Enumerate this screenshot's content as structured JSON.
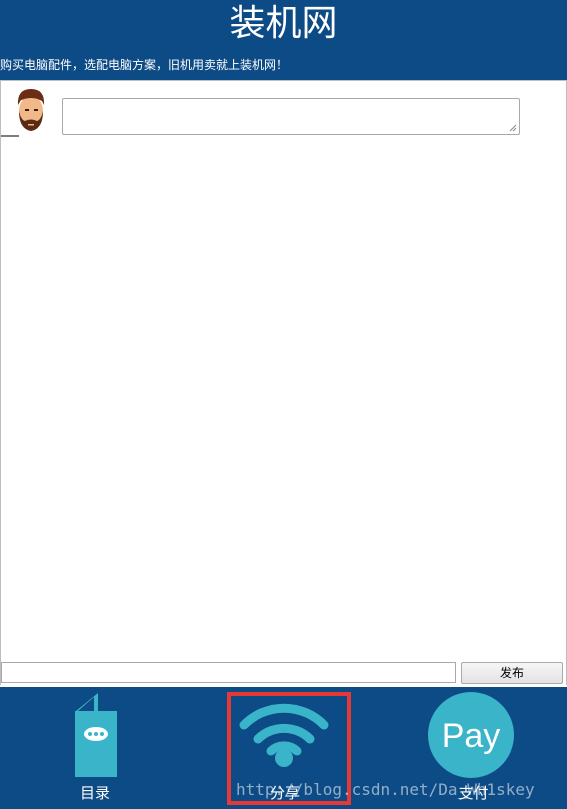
{
  "header": {
    "title": "装机网",
    "slogan": "购买电脑配件，选配电脑方案，旧机用卖就上装机网！"
  },
  "comment": {
    "value": "",
    "placeholder": ""
  },
  "post_bar": {
    "input_value": "",
    "button_label": "发布"
  },
  "nav": {
    "items": [
      {
        "label": "目录",
        "icon": "menu-booklet-icon"
      },
      {
        "label": "分享",
        "icon": "wifi-share-icon",
        "highlighted": true
      },
      {
        "label": "支付",
        "icon": "pay-icon",
        "icon_text": "Pay"
      }
    ]
  },
  "colors": {
    "brand": "#0c4b86",
    "icon_accent": "#3ab4c9",
    "highlight": "#e53935"
  },
  "watermark": "http://blog.csdn.net/Da_Wh1skey"
}
